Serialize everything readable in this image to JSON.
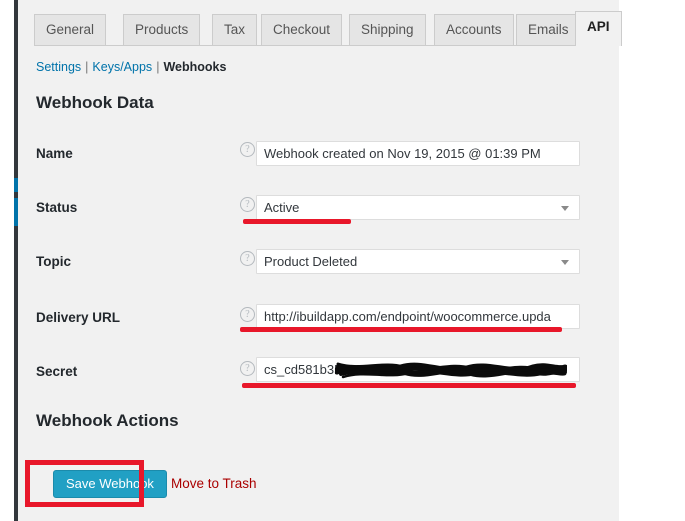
{
  "tabs": [
    {
      "label": "General",
      "active": false
    },
    {
      "label": "Products",
      "active": false
    },
    {
      "label": "Tax",
      "active": false
    },
    {
      "label": "Checkout",
      "active": false
    },
    {
      "label": "Shipping",
      "active": false
    },
    {
      "label": "Accounts",
      "active": false
    },
    {
      "label": "Emails",
      "active": false
    },
    {
      "label": "API",
      "active": true
    }
  ],
  "subnav": {
    "settings_label": "Settings",
    "keys_apps_label": "Keys/Apps",
    "webhooks_label": "Webhooks",
    "separator": "|"
  },
  "headings": {
    "webhook_data": "Webhook Data",
    "webhook_actions": "Webhook Actions"
  },
  "help_icon_glyph": "?",
  "fields": {
    "name": {
      "label": "Name",
      "value": "Webhook created on Nov 19, 2015 @ 01:39 PM"
    },
    "status": {
      "label": "Status",
      "value": "Active"
    },
    "topic": {
      "label": "Topic",
      "value": "Product Deleted"
    },
    "delivery_url": {
      "label": "Delivery URL",
      "value": "http://ibuildapp.com/endpoint/woocommerce.upda"
    },
    "secret": {
      "label": "Secret",
      "value": "cs_cd581b35aa5188358"
    }
  },
  "actions": {
    "save_label": "Save Webhook",
    "trash_label": "Move to Trash"
  },
  "colors": {
    "accent_blue": "#0073aa",
    "button_blue": "#21a0c4",
    "annotation_red": "#e8172a",
    "trash_red": "#a00",
    "page_background": "#f1f1f1",
    "admin_bar": "#32373c"
  }
}
